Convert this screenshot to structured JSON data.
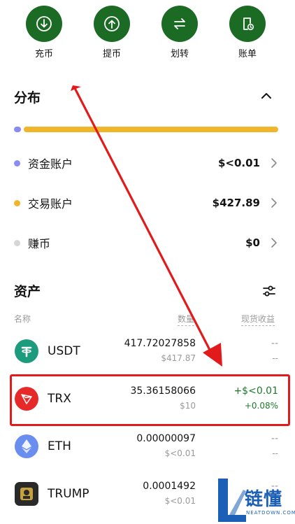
{
  "actions": [
    {
      "label": "充币",
      "icon": "download-icon"
    },
    {
      "label": "提币",
      "icon": "upload-icon"
    },
    {
      "label": "划转",
      "icon": "transfer-icon"
    },
    {
      "label": "账单",
      "icon": "bill-icon"
    }
  ],
  "distribution": {
    "title": "分布",
    "bar_fractions": [
      0.0,
      1.0
    ],
    "accounts": [
      {
        "name": "资金账户",
        "value": "$<0.01",
        "color": "#8a8cf0"
      },
      {
        "name": "交易账户",
        "value": "$427.89",
        "color": "#f0b52b"
      },
      {
        "name": "赚币",
        "value": "$0",
        "color": "#d6d6d6"
      }
    ]
  },
  "assets": {
    "title": "资产",
    "headers": {
      "name": "名称",
      "amount": "数量",
      "pnl": "现货收益"
    },
    "rows": [
      {
        "coin": "USDT",
        "amount": "417.72027858",
        "usd": "$417.87",
        "pnl": "--",
        "pnl_pct": "--"
      },
      {
        "coin": "TRX",
        "amount": "35.36158066",
        "usd": "$10",
        "pnl": "+$<0.01",
        "pnl_pct": "+0.08%"
      },
      {
        "coin": "ETH",
        "amount": "0.00000097",
        "usd": "$<0.01",
        "pnl": "--",
        "pnl_pct": "--"
      },
      {
        "coin": "TRUMP",
        "amount": "0.0001492",
        "usd": "$<0.01",
        "pnl": "--",
        "pnl_pct": "--"
      }
    ]
  },
  "colors": {
    "accent_green": "#1c6b25",
    "positive": "#1c7a2a",
    "highlight": "#e11b1b"
  },
  "watermark": {
    "text": "链懂",
    "sub": "NEATDOWN.COM"
  }
}
